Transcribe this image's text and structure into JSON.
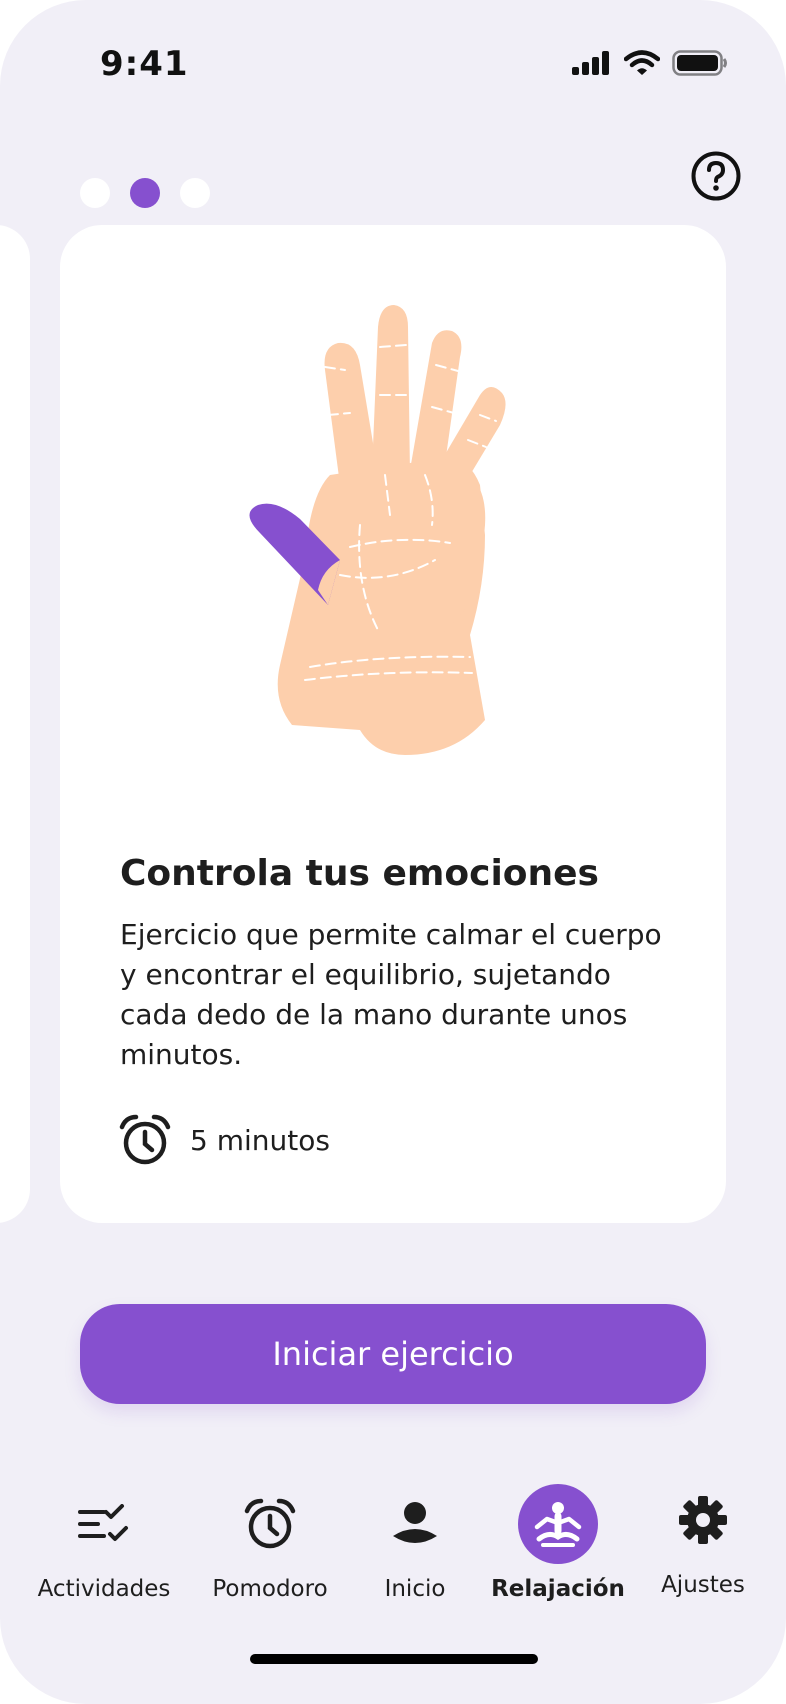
{
  "status_bar": {
    "time": "9:41",
    "icons": [
      "signal-icon",
      "wifi-icon",
      "battery-icon"
    ]
  },
  "pager": {
    "count": 3,
    "active_index": 1
  },
  "help": {
    "icon": "help-circle-icon"
  },
  "card": {
    "title": "Controla tus emociones",
    "description": "Ejercicio que permite calmar el cuerpo y encontrar el equilibrio, sujetando cada dedo de la mano durante unos minutos.",
    "duration": "5 minutos",
    "illustration": "hand-illustration",
    "highlight_color": "#8650cf",
    "skin_color": "#fdcfac"
  },
  "start_button": {
    "label": "Iniciar ejercicio"
  },
  "nav": {
    "items": [
      {
        "label": "Actividades",
        "icon": "checklist-icon",
        "active": false
      },
      {
        "label": "Pomodoro",
        "icon": "alarm-clock-icon",
        "active": false
      },
      {
        "label": "Inicio",
        "icon": "user-icon",
        "active": false
      },
      {
        "label": "Relajación",
        "icon": "meditation-icon",
        "active": true
      },
      {
        "label": "Ajustes",
        "icon": "gear-icon",
        "active": false
      }
    ]
  },
  "colors": {
    "accent": "#8650cf",
    "background": "#f1eff7",
    "card": "#ffffff",
    "text": "#1e1e1e"
  }
}
